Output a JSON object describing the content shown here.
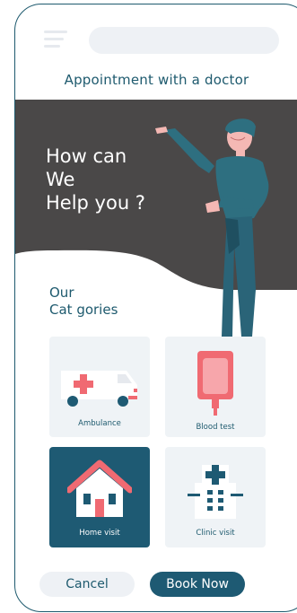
{
  "header": {
    "title": "Appointment with a doctor",
    "menu_icon": "hamburger-menu-icon",
    "search_placeholder": ""
  },
  "hero": {
    "text": "How can\nWe\nHelp you ?",
    "background": "#4a4848"
  },
  "categories": {
    "title": "Our\nCat  gories",
    "items": [
      {
        "label": "Ambulance",
        "icon": "ambulance-icon",
        "active": false
      },
      {
        "label": "Blood test",
        "icon": "blood-bag-icon",
        "active": false
      },
      {
        "label": "Home visit",
        "icon": "house-icon",
        "active": true
      },
      {
        "label": "Clinic visit",
        "icon": "hospital-icon",
        "active": false
      }
    ]
  },
  "actions": {
    "cancel_label": "Cancel",
    "book_label": "Book Now"
  },
  "colors": {
    "primary": "#1e5a73",
    "accent_red": "#f06a72",
    "surface": "#eff3f6"
  }
}
